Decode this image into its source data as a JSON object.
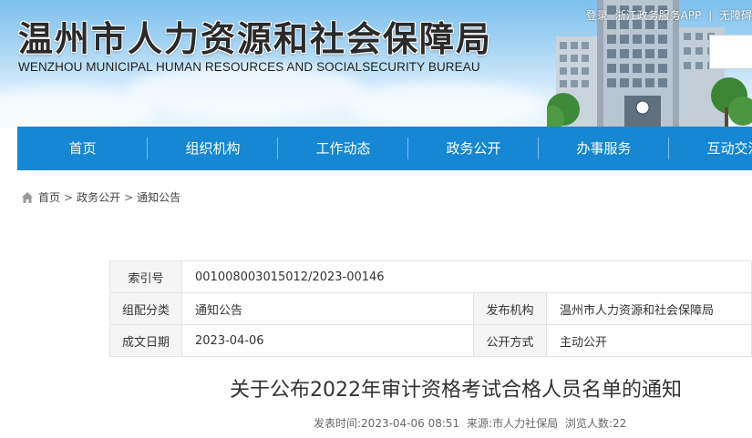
{
  "header": {
    "title": "温州市人力资源和社会保障局",
    "subtitle": "WENZHOU MUNICIPAL HUMAN RESOURCES AND SOCIALSECURITY BUREAU",
    "top_links": {
      "login": "登录",
      "separator1": "|",
      "app": "浙江政务服务APP",
      "separator2": "|",
      "accessibility": "无障碍"
    }
  },
  "nav": {
    "items": [
      {
        "label": "首页"
      },
      {
        "label": "组织机构"
      },
      {
        "label": "工作动态"
      },
      {
        "label": "政务公开"
      },
      {
        "label": "办事服务"
      },
      {
        "label": "互动交流"
      }
    ],
    "color": "#1587d3"
  },
  "breadcrumb": {
    "home": "首页",
    "level1": "政务公开",
    "level2": "通知公告",
    "sep": ">"
  },
  "meta": {
    "index_label": "索引号",
    "index_value": "001008003015012/2023-00146",
    "category_label": "组配分类",
    "category_value": "通知公告",
    "publisher_label": "发布机构",
    "publisher_value": "温州市人力资源和社会保障局",
    "date_label": "成文日期",
    "date_value": "2023-04-06",
    "disclosure_label": "公开方式",
    "disclosure_value": "主动公开"
  },
  "article": {
    "title": "关于公布2022年审计资格考试合格人员名单的通知",
    "publish_time_label": "发表时间:",
    "publish_time": "2023-04-06 08:51",
    "source_label": "来源:",
    "source": "市人力社保局",
    "views_label": "浏览人数:",
    "views": "22"
  }
}
